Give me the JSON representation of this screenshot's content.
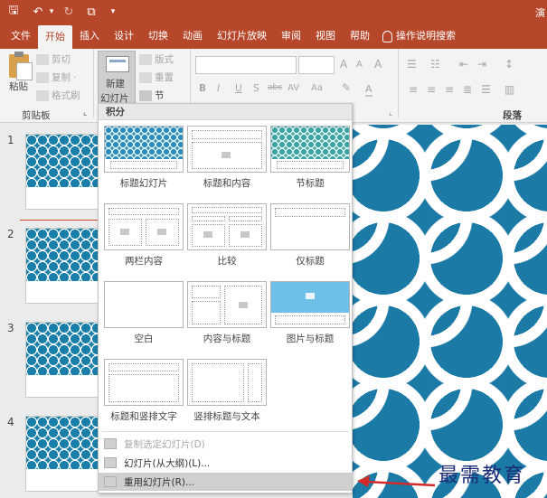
{
  "titlebar": {
    "save_glyph": "🖫",
    "undo_glyph": "↶",
    "redo_glyph": "↻",
    "present_glyph": "⧉",
    "more_glyph": "▾",
    "title_partial": "演"
  },
  "tabs": [
    "文件",
    "开始",
    "插入",
    "设计",
    "切换",
    "动画",
    "幻灯片放映",
    "审阅",
    "视图",
    "帮助"
  ],
  "tellme": "操作说明搜索",
  "ribbon": {
    "paste": "粘贴",
    "cut": "剪切",
    "copy": "复制",
    "copy_caret": "·",
    "format_painter": "格式刷",
    "clipboard_group": "剪贴板",
    "clipboard_launcher": "⌞",
    "new_slide_line1": "新建",
    "new_slide_line2": "幻灯片",
    "layout": "版式",
    "reset": "重置",
    "section": "节",
    "font_grow": "A",
    "font_shrink": "A",
    "clear_format": "A",
    "bold": "B",
    "italic": "I",
    "underline": "U",
    "shadow": "S",
    "strike": "abc",
    "spacing": "AV",
    "case": "Aa",
    "font_color": "A",
    "paragraph_group": "段落",
    "slides_group_launcher": "⌞"
  },
  "slides": [
    {
      "number": "1"
    },
    {
      "number": "2"
    },
    {
      "number": "3"
    },
    {
      "number": "4"
    }
  ],
  "dropdown": {
    "header": "积分",
    "layouts": [
      "标题幻灯片",
      "标题和内容",
      "节标题",
      "两栏内容",
      "比较",
      "仅标题",
      "空白",
      "内容与标题",
      "图片与标题",
      "标题和竖排文字",
      "竖排标题与文本"
    ],
    "menu": [
      {
        "label": "复制选定幻灯片(D)",
        "disabled": true
      },
      {
        "label": "幻灯片(从大纲)(L)...",
        "disabled": false
      },
      {
        "label": "重用幻灯片(R)...",
        "highlighted": true
      }
    ]
  },
  "watermark": "最需教育",
  "colors": {
    "accent": "#b7472a",
    "slide_blue": "#1b7aa6",
    "arrow": "#d52a2a",
    "watermark": "#1c2d78"
  }
}
